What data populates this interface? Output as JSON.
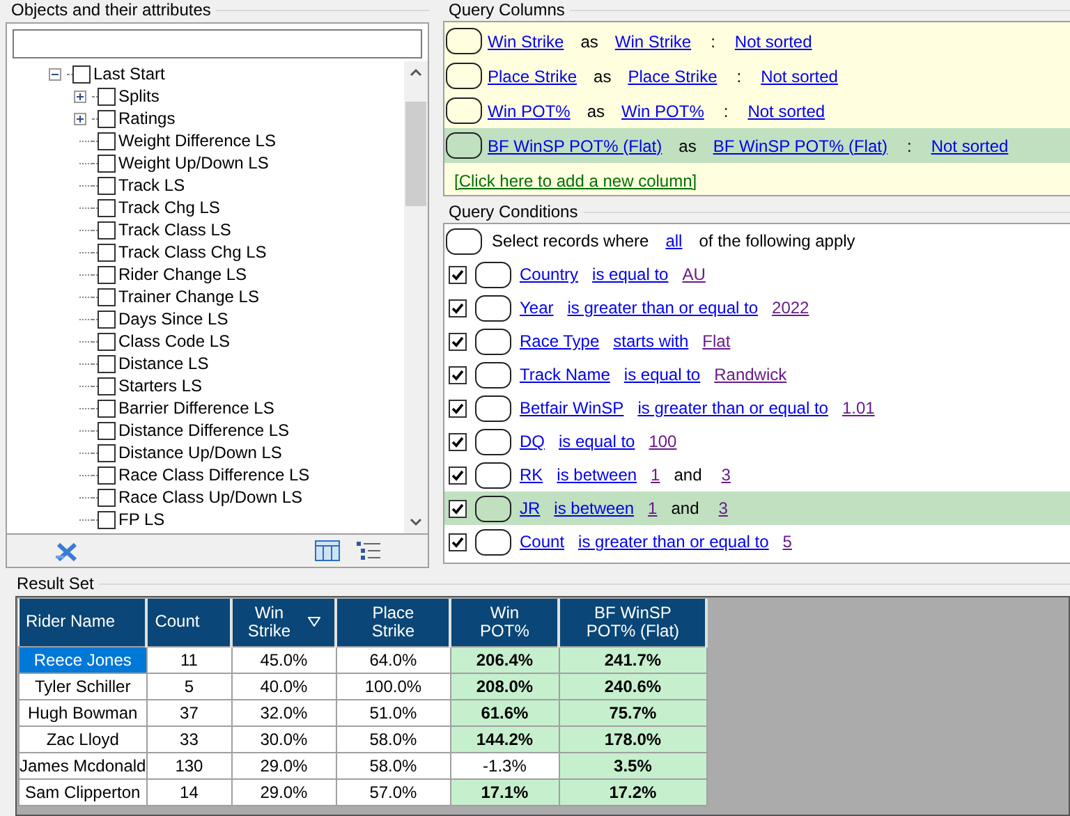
{
  "objects_panel": {
    "title": "Objects and their attributes",
    "tree": [
      {
        "label": "Last Start",
        "checked": false,
        "expanded": true,
        "children": [
          {
            "label": "Splits",
            "checked": false,
            "expanded": false
          },
          {
            "label": "Ratings",
            "checked": false,
            "expanded": false
          },
          {
            "label": "Weight Difference LS",
            "checked": false
          },
          {
            "label": "Weight Up/Down LS",
            "checked": false
          },
          {
            "label": "Track LS",
            "checked": false
          },
          {
            "label": "Track Chg LS",
            "checked": false
          },
          {
            "label": "Track Class LS",
            "checked": false
          },
          {
            "label": "Track Class Chg LS",
            "checked": false
          },
          {
            "label": "Rider Change LS",
            "checked": false
          },
          {
            "label": "Trainer Change LS",
            "checked": false
          },
          {
            "label": "Days Since LS",
            "checked": false
          },
          {
            "label": "Class Code LS",
            "checked": false
          },
          {
            "label": "Distance LS",
            "checked": false
          },
          {
            "label": "Starters LS",
            "checked": false
          },
          {
            "label": "Barrier Difference LS",
            "checked": false
          },
          {
            "label": "Distance Difference LS",
            "checked": false
          },
          {
            "label": "Distance Up/Down LS",
            "checked": false
          },
          {
            "label": "Race Class Difference LS",
            "checked": false
          },
          {
            "label": "Race Class Up/Down LS",
            "checked": false
          },
          {
            "label": "FP LS",
            "checked": false
          }
        ]
      }
    ]
  },
  "query_columns": {
    "title": "Query Columns",
    "rows": [
      {
        "field": "Win Strike",
        "as": "as",
        "alias": "Win Strike",
        "sep": ":",
        "sort": "Not sorted",
        "selected": false
      },
      {
        "field": "Place Strike",
        "as": "as",
        "alias": "Place Strike",
        "sep": ":",
        "sort": "Not sorted",
        "selected": false
      },
      {
        "field": "Win POT%",
        "as": "as",
        "alias": "Win POT%",
        "sep": ":",
        "sort": "Not sorted",
        "selected": false
      },
      {
        "field": "BF WinSP POT% (Flat)",
        "as": "as",
        "alias": "BF WinSP POT% (Flat)",
        "sep": ":",
        "sort": "Not sorted",
        "selected": true
      }
    ],
    "add_link": "[Click here to add a new column]"
  },
  "query_conditions": {
    "title": "Query Conditions",
    "intro": {
      "before": "Select records where",
      "mode": "all",
      "after": "of the following apply"
    },
    "rows": [
      {
        "checked": true,
        "selected": false,
        "field": "Country",
        "operator": "is equal to",
        "values": [
          "AU"
        ]
      },
      {
        "checked": true,
        "selected": false,
        "field": "Year",
        "operator": "is greater than or equal to",
        "values": [
          "2022"
        ]
      },
      {
        "checked": true,
        "selected": false,
        "field": "Race Type",
        "operator": "starts with",
        "values": [
          "Flat"
        ]
      },
      {
        "checked": true,
        "selected": false,
        "field": "Track Name",
        "operator": "is equal to",
        "values": [
          "Randwick"
        ]
      },
      {
        "checked": true,
        "selected": false,
        "field": "Betfair WinSP",
        "operator": "is greater than or equal to",
        "values": [
          "1.01"
        ]
      },
      {
        "checked": true,
        "selected": false,
        "field": "DQ",
        "operator": "is equal to",
        "values": [
          "100"
        ]
      },
      {
        "checked": true,
        "selected": false,
        "field": "RK",
        "operator": "is between",
        "values": [
          "1",
          "3"
        ],
        "joiner": "and"
      },
      {
        "checked": true,
        "selected": true,
        "field": "JR",
        "operator": "is between",
        "values": [
          "1",
          "3"
        ],
        "joiner": "and"
      },
      {
        "checked": true,
        "selected": false,
        "field": "Count",
        "operator": "is greater than or equal to",
        "values": [
          "5"
        ]
      }
    ]
  },
  "result_set": {
    "title": "Result Set",
    "columns": [
      {
        "label": "Rider Name",
        "sorted": false
      },
      {
        "label": "Count",
        "sorted": false
      },
      {
        "label": "Win\nStrike",
        "sorted": true
      },
      {
        "label": "Place\nStrike",
        "sorted": false
      },
      {
        "label": "Win\nPOT%",
        "sorted": false
      },
      {
        "label": "BF WinSP\nPOT% (Flat)",
        "sorted": false
      }
    ],
    "rows": [
      {
        "selected": true,
        "cells": [
          {
            "text": "Reece Jones"
          },
          {
            "text": "11",
            "highlight": false
          },
          {
            "text": "45.0%",
            "highlight": false
          },
          {
            "text": "64.0%",
            "highlight": false
          },
          {
            "text": "206.4%",
            "highlight": true
          },
          {
            "text": "241.7%",
            "highlight": true
          }
        ]
      },
      {
        "selected": false,
        "cells": [
          {
            "text": "Tyler Schiller"
          },
          {
            "text": "5",
            "highlight": false
          },
          {
            "text": "40.0%",
            "highlight": false
          },
          {
            "text": "100.0%",
            "highlight": false
          },
          {
            "text": "208.0%",
            "highlight": true
          },
          {
            "text": "240.6%",
            "highlight": true
          }
        ]
      },
      {
        "selected": false,
        "cells": [
          {
            "text": "Hugh Bowman"
          },
          {
            "text": "37",
            "highlight": false
          },
          {
            "text": "32.0%",
            "highlight": false
          },
          {
            "text": "51.0%",
            "highlight": false
          },
          {
            "text": "61.6%",
            "highlight": true
          },
          {
            "text": "75.7%",
            "highlight": true
          }
        ]
      },
      {
        "selected": false,
        "cells": [
          {
            "text": "Zac Lloyd"
          },
          {
            "text": "33",
            "highlight": false
          },
          {
            "text": "30.0%",
            "highlight": false
          },
          {
            "text": "58.0%",
            "highlight": false
          },
          {
            "text": "144.2%",
            "highlight": true
          },
          {
            "text": "178.0%",
            "highlight": true
          }
        ]
      },
      {
        "selected": false,
        "cells": [
          {
            "text": "James Mcdonald"
          },
          {
            "text": "130",
            "highlight": false
          },
          {
            "text": "29.0%",
            "highlight": false
          },
          {
            "text": "58.0%",
            "highlight": false
          },
          {
            "text": "-1.3%",
            "highlight": false
          },
          {
            "text": "3.5%",
            "highlight": true
          }
        ]
      },
      {
        "selected": false,
        "cells": [
          {
            "text": "Sam Clipperton"
          },
          {
            "text": "14",
            "highlight": false
          },
          {
            "text": "29.0%",
            "highlight": false
          },
          {
            "text": "57.0%",
            "highlight": false
          },
          {
            "text": "17.1%",
            "highlight": true
          },
          {
            "text": "17.2%",
            "highlight": true
          }
        ]
      }
    ]
  }
}
